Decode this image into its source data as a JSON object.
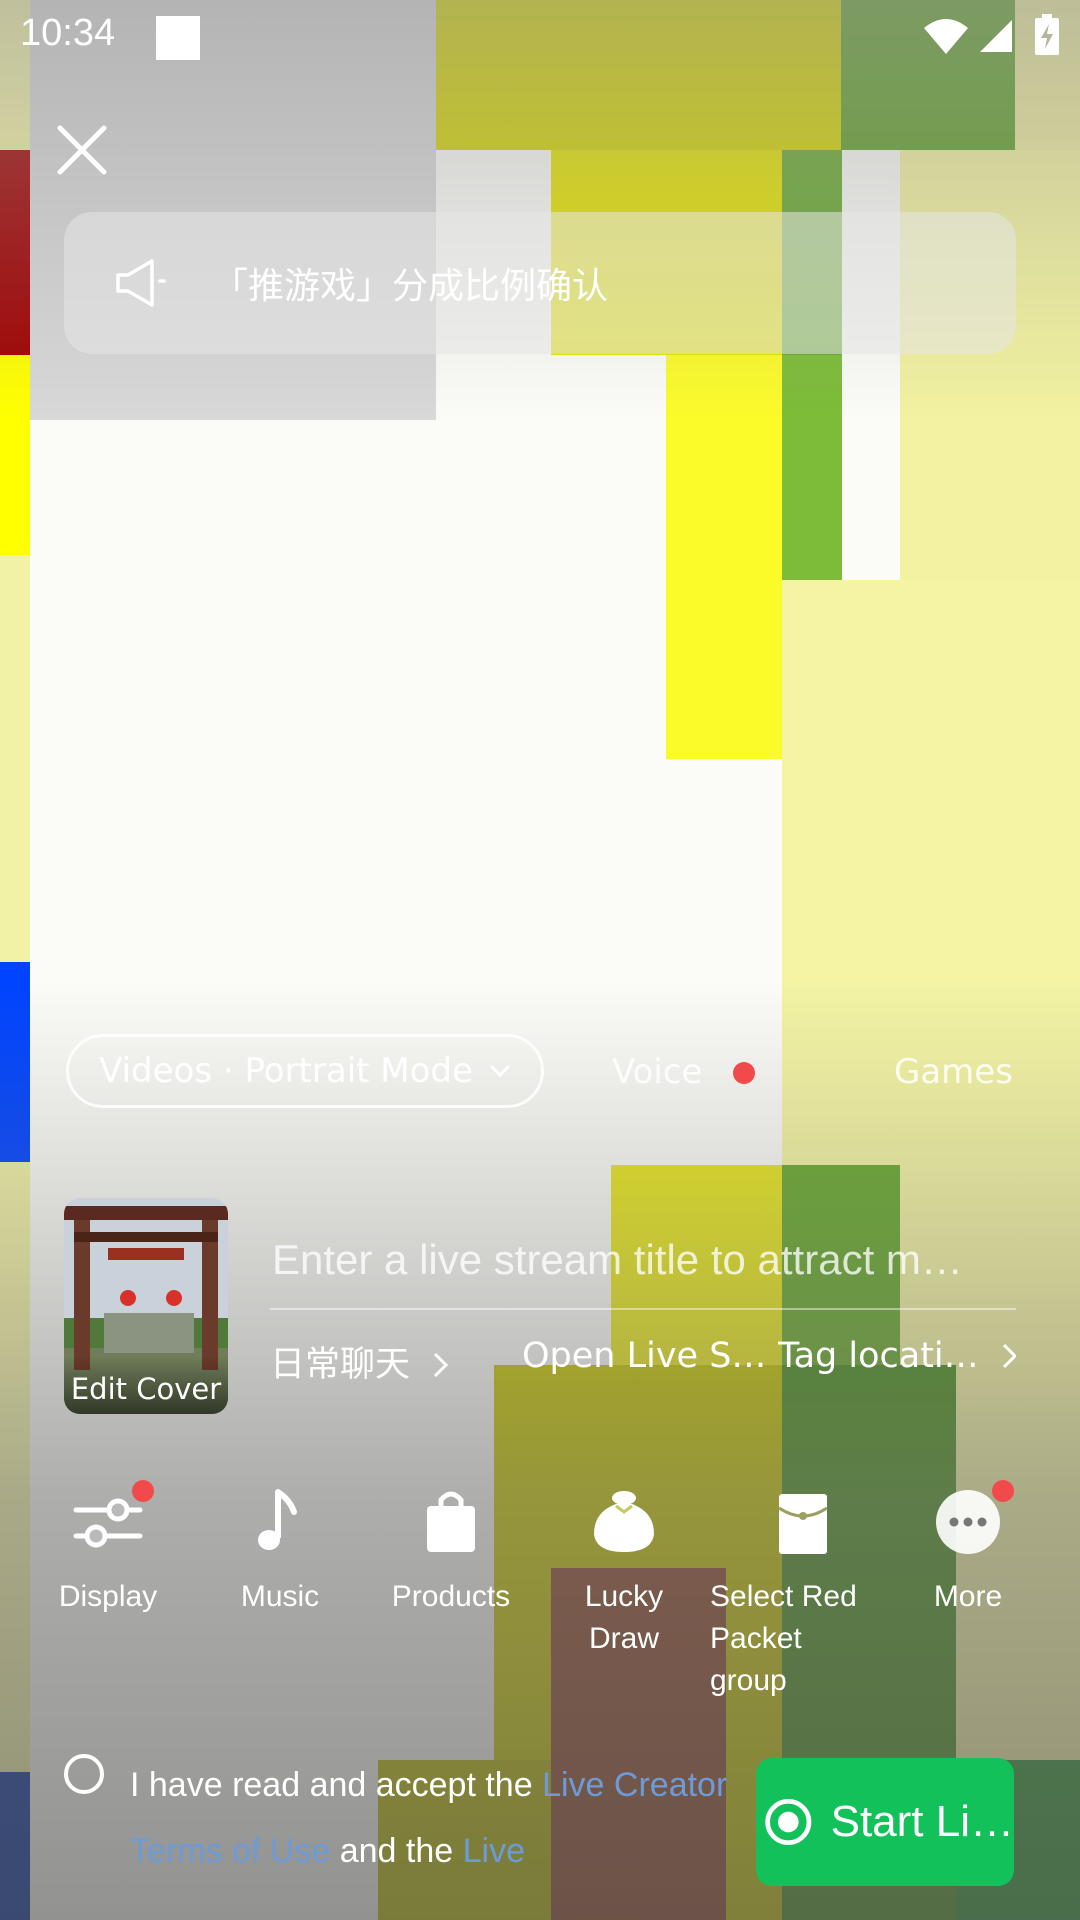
{
  "status_bar": {
    "time": "10:34"
  },
  "notice": {
    "text": "「推游戏」分成比例确认"
  },
  "modes": {
    "selected": "Videos · Portrait Mode",
    "voice": "Voice",
    "games": "Games"
  },
  "cover": {
    "label": "Edit Cover"
  },
  "title_input": {
    "placeholder": "Enter a live stream title to attract m…"
  },
  "meta": {
    "category": "日常聊天",
    "open_live": "Open Live Str…",
    "location": "Tag locati…"
  },
  "tools": [
    {
      "label": "Display",
      "icon": "sliders-icon"
    },
    {
      "label": "Music",
      "icon": "music-note-icon"
    },
    {
      "label": "Products",
      "icon": "shopping-bag-icon"
    },
    {
      "label": "Lucky Draw",
      "icon": "lucky-bag-icon"
    },
    {
      "label": "Select Red Packet group",
      "icon": "red-packet-icon"
    },
    {
      "label": "More",
      "icon": "more-icon"
    }
  ],
  "agreement": {
    "prefix": "I have read and accept the",
    "link1": "Live",
    "link1b": "Creator Terms of Use",
    "middle": "and the",
    "link2": "Live"
  },
  "start_button": {
    "label": "Start Li…"
  },
  "colors": {
    "accent_green": "#13c15a",
    "badge_red": "#f24a4a",
    "link_blue": "#6e9bd8"
  }
}
